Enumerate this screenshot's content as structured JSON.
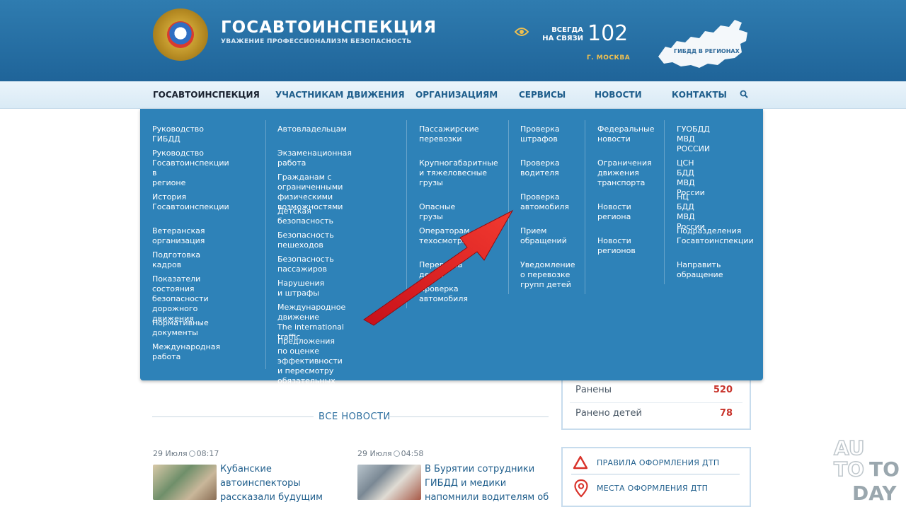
{
  "header": {
    "brand_title": "ГОСАВТОИНСПЕКЦИЯ",
    "brand_subtitle": "УВАЖЕНИЕ ПРОФЕССИОНАЛИЗМ БЕЗОПАСНОСТЬ",
    "always_line1": "ВСЕГДА",
    "always_line2": "НА СВЯЗИ",
    "hotline": "102",
    "city": "Г. МОСКВА",
    "regions_label": "ГИБДД В РЕГИОНАХ"
  },
  "nav": {
    "items": [
      {
        "label": "ГОСАВТОИНСПЕКЦИЯ"
      },
      {
        "label": "УЧАСТНИКАМ ДВИЖЕНИЯ"
      },
      {
        "label": "ОРГАНИЗАЦИЯМ"
      },
      {
        "label": "СЕРВИСЫ"
      },
      {
        "label": "НОВОСТИ"
      },
      {
        "label": "КОНТАКТЫ"
      }
    ]
  },
  "menu": {
    "columns": [
      {
        "links": [
          "Руководство ГИБДД",
          "Руководство\nГосавтоинспекции в\nрегионе",
          "История\nГосавтоинспекции",
          "Ветеранская организация",
          "Подготовка кадров",
          "Показатели состояния\nбезопасности дорожного\nдвижения",
          "Нормативные документы",
          "Международная работа"
        ]
      },
      {
        "links": [
          "Автовладельцам",
          "Экзаменационная работа",
          "Гражданам с ограниченными\nфизическими возможностями",
          "Детская безопасность",
          "Безопасность пешеходов",
          "Безопасность пассажиров",
          "Нарушения и штрафы",
          "Международное движение\nThe international traffic",
          "Предложения по оценке\nэффективности и пересмотру\nобязательных требований"
        ]
      },
      {
        "links": [
          "Пассажирские\nперевозки",
          "Крупногабаритные\nи тяжеловесные\nгрузы",
          "Опасные грузы",
          "Операторам\nтехосмотра",
          "Перевозка детей",
          "Проверка\nавтомобиля"
        ]
      },
      {
        "links": [
          "Проверка\nштрафов",
          "Проверка\nводителя",
          "Проверка\nавтомобиля",
          "Прием\nобращений",
          "Уведомление\nо перевозке\nгрупп детей"
        ]
      },
      {
        "links": [
          "Федеральные\nновости",
          "Ограничения\nдвижения\nтранспорта",
          "Новости\nрегиона",
          "Новости\nрегионов"
        ]
      },
      {
        "links": [
          "ГУОБДД МВД\nРОССИИ",
          "ЦСН БДД МВД\nРоссии",
          "НЦ БДД МВД\nРоссии",
          "Подразделения\nГосавтоинспекции",
          "Направить\nобращение"
        ]
      }
    ]
  },
  "stats": {
    "injured_label": "Ранены",
    "injured_value": "520",
    "children_label": "Ранено детей",
    "children_value": "78"
  },
  "news": {
    "heading": "ВСЕ НОВОСТИ",
    "items": [
      {
        "date": "29 Июля",
        "time": "08:17",
        "title": "Кубанские\nавтоинспекторы\nрассказали будущим"
      },
      {
        "date": "29 Июля",
        "time": "04:58",
        "title": "В Бурятии сотрудники\nГИБДД и медики\nнапомнили водителям об"
      }
    ]
  },
  "links": {
    "rules": "ПРАВИЛА ОФОРМЛЕНИЯ ДТП",
    "places": "МЕСТА ОФОРМЛЕНИЯ ДТП"
  },
  "watermark": {
    "line1": "AU",
    "line2a": "TO",
    "line2b": "TO",
    "line3": "DAY"
  },
  "colors": {
    "header_blue": "#1f6499",
    "menu_blue": "#2e82b8",
    "accent_gold": "#f0c050",
    "stat_red": "#c8332b",
    "arrow_red": "#e8262a"
  }
}
